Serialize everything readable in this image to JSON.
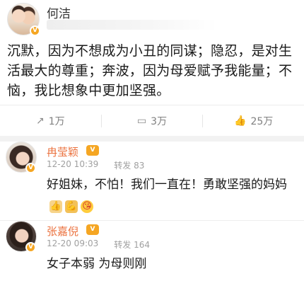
{
  "post": {
    "author": "何洁",
    "author_avatar_icon": "avatar-photo",
    "verified_icon": "v-badge-icon",
    "verified_label": "V",
    "text": "沉默，因为不想成为小丑的同谋；隐忍，是对生活最大的尊重；奔波，因为母爱赋予我能量；不恼，我比想象中更加坚强。"
  },
  "actions": [
    {
      "icon": "repost-icon",
      "glyph": "↗",
      "label": "1万"
    },
    {
      "icon": "comment-icon",
      "glyph": "▭",
      "label": "3万"
    },
    {
      "icon": "like-icon",
      "glyph": "👍",
      "label": "25万"
    }
  ],
  "comments": [
    {
      "author": "冉莹颖",
      "vip_label": "V",
      "time": "12-20 10:39",
      "forward": "转发 83",
      "text": "好姐妹，不怕！我们一直在！勇敢坚强的妈妈",
      "emojis": [
        "👍",
        "💪",
        "😘"
      ]
    },
    {
      "author": "张嘉倪",
      "vip_label": "V",
      "time": "12-20 09:03",
      "forward": "转发 164",
      "text": "女子本弱 为母则刚",
      "emojis": []
    }
  ],
  "colors": {
    "name_accent": "#eb7340",
    "badge": "#f5a623",
    "meta_gray": "#a0a0a0"
  }
}
